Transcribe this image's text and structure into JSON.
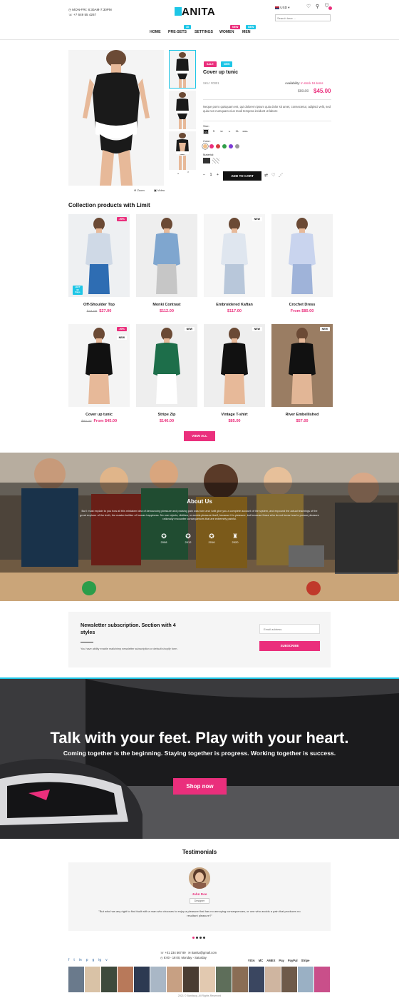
{
  "header": {
    "hours": "MON-FRI: 8:30AM-7:30PM",
    "phone": "+7 649 55 4267",
    "logo": "BANITA",
    "currency": "USD",
    "search_placeholder": "Search here ..."
  },
  "nav": {
    "items": [
      {
        "label": "HOME"
      },
      {
        "label": "PRE-SETS",
        "badge": "10"
      },
      {
        "label": "SETTINGS"
      },
      {
        "label": "WOMEN",
        "badge": "NEW"
      },
      {
        "label": "MEN",
        "badge": "NEW"
      }
    ]
  },
  "product": {
    "labels": [
      "SALE",
      "NEW"
    ],
    "title": "Cover up tunic",
    "sku": "SKU: #0001",
    "availability": "Availability:",
    "stock": "In stock 16 items",
    "old_price": "$80.00",
    "price": "$45.00",
    "description": "Neque porro quisquam est, qui dolorem ipsum quia dolor sit amet, consectetur, adipisci velit, sed quia non numquam eius modi tempora incidunt ut labore",
    "size_label": "Size:",
    "sizes": [
      "XS",
      "S",
      "M",
      "L",
      "XL",
      "XXL"
    ],
    "color_label": "Color:",
    "colors": [
      "#f1c08a",
      "#ea2f7c",
      "#d63b3b",
      "#2e9e48",
      "#7c3bd6",
      "#999999"
    ],
    "material_label": "Material:",
    "qty": "1",
    "add_to_cart": "ADD TO CART",
    "zoom": "Zoom",
    "video": "Video"
  },
  "collection": {
    "title": "Collection products with Limit",
    "items": [
      {
        "name": "Off-Shoulder Top",
        "old": "$34.00",
        "price": "$27.00",
        "badge": "-90%",
        "stock": "LEFT 90 Days"
      },
      {
        "name": "Monki Contrast",
        "old": "",
        "price": "$112.00",
        "badge": ""
      },
      {
        "name": "Embroidered Kaftan",
        "old": "",
        "price": "$117.00",
        "badge": "NEW"
      },
      {
        "name": "Crochet Dress",
        "old": "",
        "price": "From $80.00",
        "badge": ""
      },
      {
        "name": "Cover up tunic",
        "old": "$80.00",
        "price": "From $45.00",
        "badge": "-90%",
        "badge2": "NEW"
      },
      {
        "name": "Stripe Zip",
        "old": "",
        "price": "$146.00",
        "badge": "NEW"
      },
      {
        "name": "Vintage T-shirt",
        "old": "",
        "price": "$85.00",
        "badge": "NEW"
      },
      {
        "name": "River Embellished",
        "old": "",
        "price": "$57.00",
        "badge": "NEW"
      }
    ],
    "view_all": "VIEW ALL"
  },
  "about": {
    "title": "About Us",
    "text": "But I must explain to you how all this mistaken idea of denouncing pleasure and praising pain was born and I will give you a complete account of the system, and expound the actual teachings of the great explorer of the truth, the master-builder of human happiness. No one rejects, dislikes, or avoids pleasure itself, because it is pleasure, but because those who do not know how to pursue pleasure rationally encounter consequences that are extremely painful.",
    "awards": [
      "2008",
      "2012",
      "2016",
      "2020"
    ]
  },
  "newsletter": {
    "title": "Newsletter subscription. Section with 4 styles",
    "text": "You have ability enable mailchimp newsletter subscription or default shopify form.",
    "placeholder": "Email address",
    "button": "SUBSCRIBE"
  },
  "hero": {
    "title": "Talk with your feet. Play with your heart.",
    "subtitle": "Coming together is the beginning. Staying together is progress. Working together is success.",
    "button": "Shop now"
  },
  "testimonials": {
    "title": "Testimonials",
    "name": "John Doe",
    "role": "Designer",
    "quote": "\"But who has any right to find fault with a man who chooses to enjoy a pleasure that has no annoying consequences, or one who avoids a pain that produces no resultant pleasure?\""
  },
  "footer": {
    "phone": "+01 234 567 89",
    "email": "Banita@gmail.com",
    "hours": "8:00 - 19:00, Monday - Saturday",
    "payments": [
      "VISA",
      "MC",
      "AMEX",
      "Pay",
      "PayPal",
      "Stripe"
    ],
    "social": [
      "f",
      "t",
      "in",
      "p",
      "g",
      "ig",
      "v"
    ],
    "copyright": "2021 © Banitaop, All Rights Reserved"
  },
  "colors": {
    "accent": "#ea2f7c",
    "cyan": "#1ec6e6",
    "dark": "#111111"
  }
}
